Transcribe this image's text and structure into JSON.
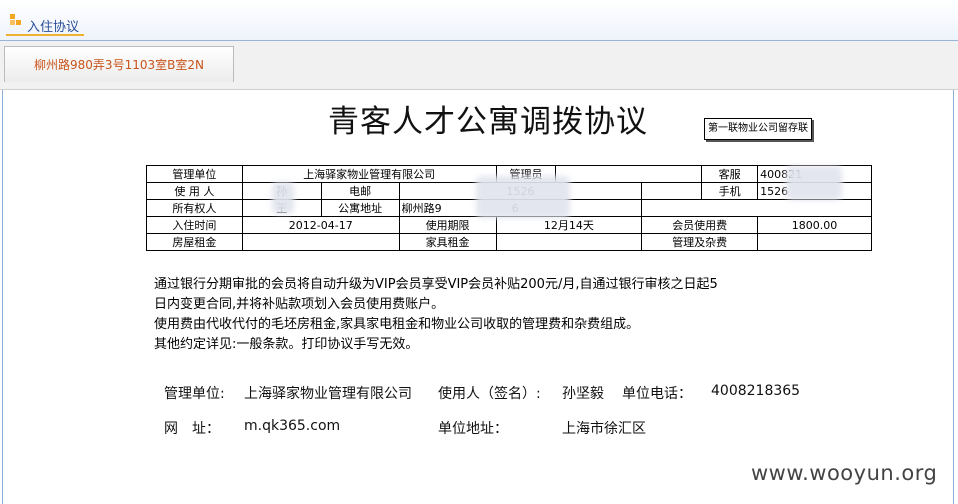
{
  "header": {
    "title": "入住协议"
  },
  "tabs": [
    {
      "label": "柳州路980弄3号1103室B室2N"
    }
  ],
  "document": {
    "title": "青客人才公寓调拨协议",
    "stamp": "第一联物业公司留存联",
    "table": {
      "row1": {
        "l1": "管理单位",
        "v1": "上海驿家物业管理有限公司",
        "l2": "管理员",
        "v2": "",
        "l3": "客服",
        "v3": "400821"
      },
      "row2": {
        "l1": "使 用 人",
        "v1": "孙",
        "l1b": "电邮",
        "v1b": "1526",
        "l3": "手机",
        "v3": "1526"
      },
      "row3": {
        "l1": "所有权人",
        "v1": "王",
        "l2": "公寓地址",
        "v2": "柳州路9",
        "v2b": "6"
      },
      "row4": {
        "l1": "入住时间",
        "v1": "2012-04-17",
        "l2": "使用期限",
        "v2": "12月14天",
        "l3": "会员使用费",
        "v3": "1800.00"
      },
      "row5": {
        "l1": "房屋租金",
        "v1": "",
        "l2": "家具租金",
        "v2": "",
        "l3": "管理及杂费",
        "v3": ""
      }
    },
    "paragraphs": [
      "通过银行分期审批的会员将自动升级为VIP会员享受VIP会员补贴200元/月,自通过银行审核之日起5",
      "日内变更合同,并将补贴款项划入会员使用费账户。",
      "使用费由代收代付的毛坯房租金,家具家电租金和物业公司收取的管理费和杂费组成。",
      "其他约定详见:一般条款。打印协议手写无效。"
    ],
    "footer": {
      "mgmt_label": "管理单位:",
      "mgmt_value": "上海驿家物业管理有限公司",
      "user_label": "使用人（签名）:",
      "user_value": "孙坚毅",
      "phone_label": "单位电话：",
      "phone_value": "4008218365",
      "site_label": "网　址：",
      "site_value": "m.qk365.com",
      "addr_label": "单位地址：",
      "addr_value": "上海市徐汇区"
    }
  },
  "watermark": "www.wooyun.org"
}
